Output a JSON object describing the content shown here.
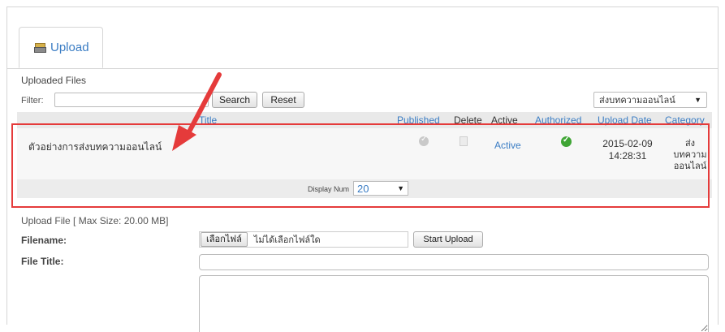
{
  "tab": {
    "label": "Upload",
    "icon": "upload-tray-icon"
  },
  "uploaded": {
    "section_title": "Uploaded Files",
    "filter_label": "Filter:",
    "filter_value": "",
    "search_label": "Search",
    "reset_label": "Reset",
    "category_filter": "ส่งบทความออนไลน์"
  },
  "table": {
    "columns": [
      "Title",
      "Published",
      "Delete",
      "Active",
      "Authorized",
      "Upload Date",
      "Category"
    ],
    "rows": [
      {
        "title": "ตัวอย่างการส่งบทความออนไลน์",
        "published_icon": "check-gray-icon",
        "delete_icon": "delete-icon",
        "active": "Active",
        "authorized_icon": "check-green-icon",
        "upload_date": "2015-02-09",
        "upload_time": "14:28:31",
        "category_lines": [
          "ส่ง",
          "บทความ",
          "ออนไลน์"
        ]
      }
    ],
    "display_num_label": "Display Num",
    "display_num_value": "20"
  },
  "upload_form": {
    "section_title": "Upload File [ Max Size: 20.00 MB]",
    "filename_label": "Filename:",
    "choose_file_label": "เลือกไฟล์",
    "no_file_text": "ไม่ได้เลือกไฟล์ใด",
    "start_upload_label": "Start Upload",
    "file_title_label": "File Title:",
    "file_title_value": "",
    "description_value": ""
  },
  "colors": {
    "link": "#3b7dc4",
    "highlight": "#e53b3b",
    "authorized": "#3fa535"
  }
}
